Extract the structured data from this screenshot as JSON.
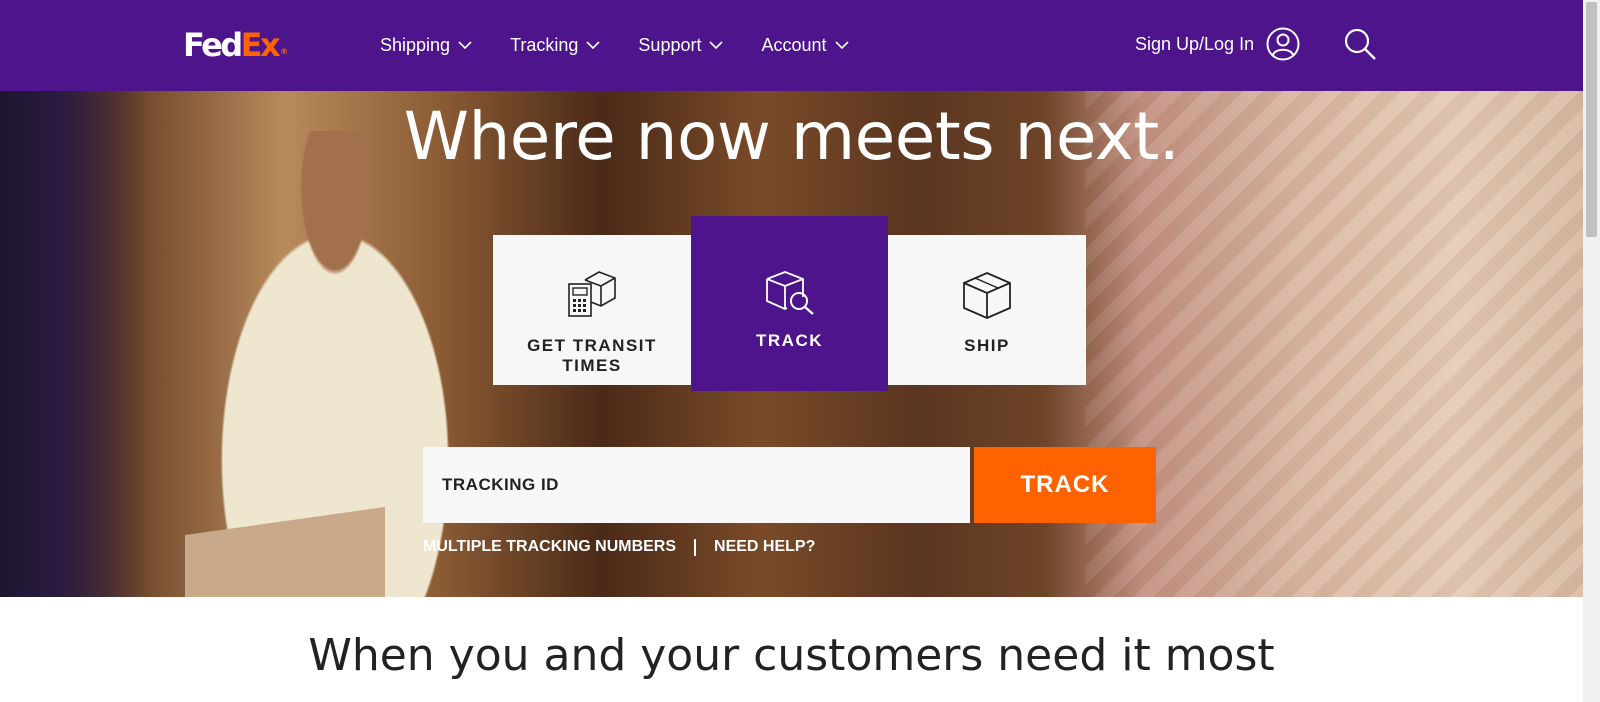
{
  "header": {
    "logo": {
      "fed": "Fed",
      "ex": "Ex",
      "reg": "®"
    },
    "nav": [
      {
        "label": "Shipping"
      },
      {
        "label": "Tracking"
      },
      {
        "label": "Support"
      },
      {
        "label": "Account"
      }
    ],
    "signin_label": "Sign Up/Log In",
    "icons": {
      "user": "user-circle-icon",
      "search": "search-icon",
      "chevron": "chevron-down-icon"
    }
  },
  "hero": {
    "headline": "Where now meets next.",
    "tabs": [
      {
        "label": "GET TRANSIT TIMES",
        "icon": "calculator-package-icon"
      },
      {
        "label": "TRACK",
        "icon": "package-search-icon",
        "active": true
      },
      {
        "label": "SHIP",
        "icon": "package-icon"
      }
    ],
    "tracking_input": {
      "placeholder": "TRACKING ID",
      "value": ""
    },
    "track_button": "TRACK",
    "links": {
      "multiple": "MULTIPLE TRACKING NUMBERS",
      "help": "NEED HELP?"
    }
  },
  "section": {
    "title": "When you and your customers need it most"
  },
  "colors": {
    "brand_purple": "#4d148c",
    "brand_orange": "#ff6200"
  }
}
